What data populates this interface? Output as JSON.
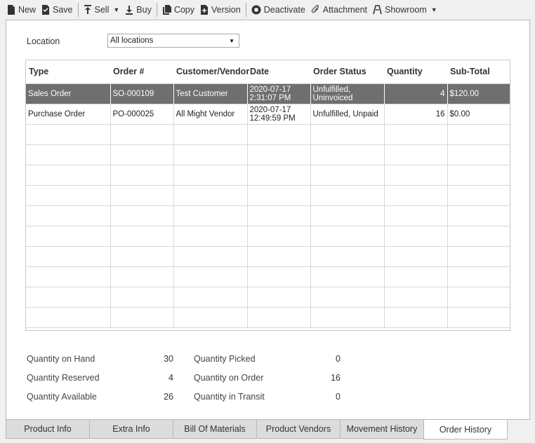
{
  "toolbar": {
    "new": "New",
    "save": "Save",
    "sell": "Sell",
    "buy": "Buy",
    "copy": "Copy",
    "version": "Version",
    "deactivate": "Deactivate",
    "attachment": "Attachment",
    "showroom": "Showroom"
  },
  "location": {
    "label": "Location",
    "value": "All locations"
  },
  "grid": {
    "headers": [
      "Type",
      "Order #",
      "Customer/Vendor",
      "Date",
      "Order Status",
      "Quantity",
      "Sub-Total"
    ],
    "rows": [
      {
        "type": "Sales Order",
        "order": "SO-000109",
        "party": "Test Customer",
        "date1": "2020-07-17",
        "date2": "2:31:07 PM",
        "status1": "Unfulfilled,",
        "status2": "Uninvoiced",
        "qty": "4",
        "subtotal": "$120.00"
      },
      {
        "type": "Purchase Order",
        "order": "PO-000025",
        "party": "All Might Vendor",
        "date1": "2020-07-17",
        "date2": "12:49:59 PM",
        "status1": "Unfulfilled, Unpaid",
        "status2": "",
        "qty": "16",
        "subtotal": "$0.00"
      }
    ]
  },
  "stats": {
    "on_hand_label": "Quantity on Hand",
    "on_hand": "30",
    "reserved_label": "Quantity Reserved",
    "reserved": "4",
    "available_label": "Quantity Available",
    "available": "26",
    "picked_label": "Quantity Picked",
    "picked": "0",
    "on_order_label": "Quantity on Order",
    "on_order": "16",
    "in_transit_label": "Quantity in Transit",
    "in_transit": "0"
  },
  "tabs": [
    "Product Info",
    "Extra Info",
    "Bill Of Materials",
    "Product Vendors",
    "Movement History",
    "Order History"
  ]
}
